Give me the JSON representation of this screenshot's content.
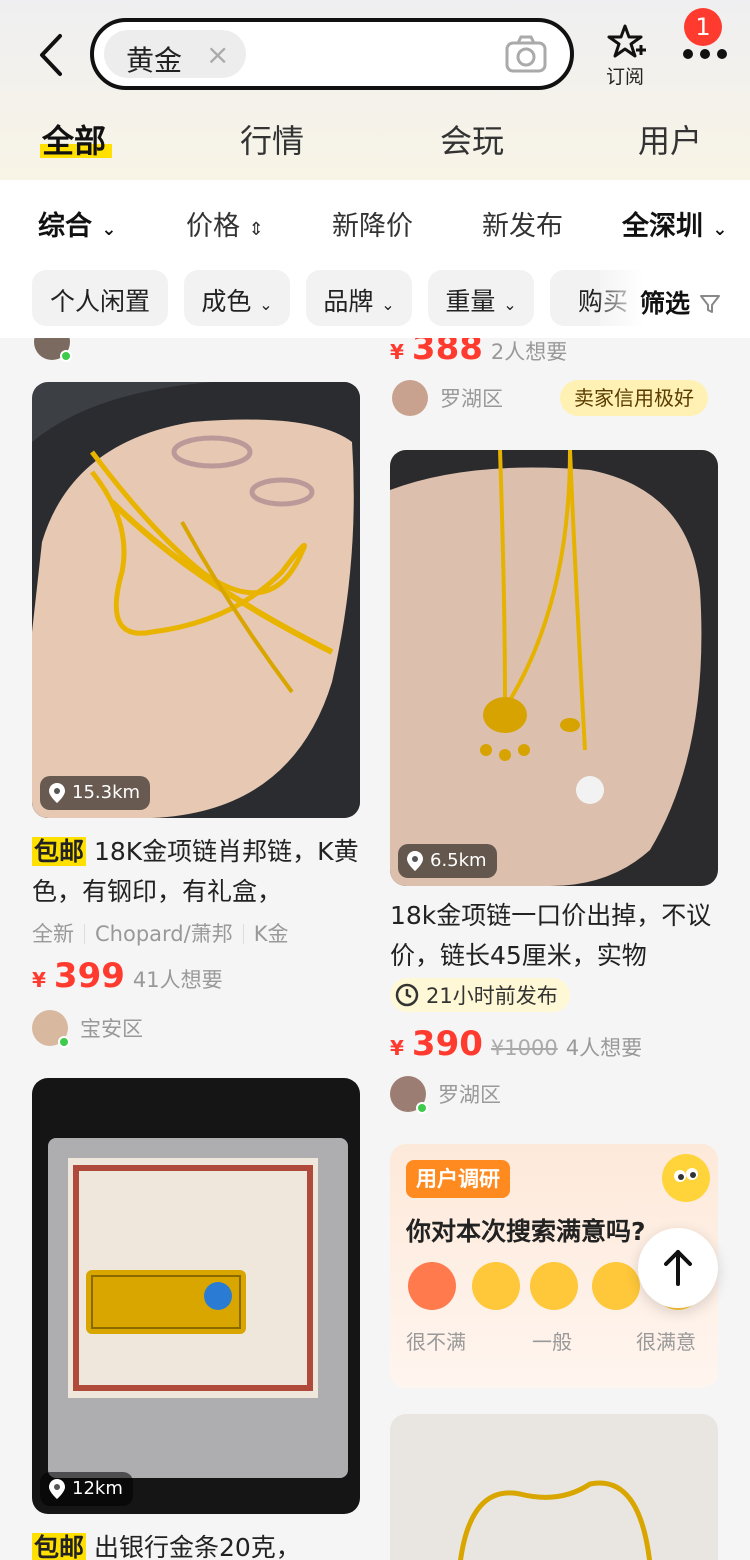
{
  "header": {
    "search_chip": "黄金",
    "subscribe_label": "订阅",
    "notification_count": "1"
  },
  "tabs": [
    "全部",
    "行情",
    "会玩",
    "用户"
  ],
  "sort": {
    "comprehensive": "综合",
    "price": "价格",
    "price_drop": "新降价",
    "new_post": "新发布",
    "region": "全深圳"
  },
  "filters": {
    "chips": [
      "个人闲置",
      "成色",
      "品牌",
      "重量",
      "购买"
    ],
    "filter_label": "筛选"
  },
  "partial_top": {
    "price": "388",
    "want": "2人想要",
    "area": "罗湖区",
    "credit": "卖家信用极好"
  },
  "items": [
    {
      "distance": "15.3km",
      "badge": "包邮",
      "title": "18K金项链肖邦链，K黄色，有钢印，有礼盒，",
      "tags": [
        "全新",
        "Chopard/萧邦",
        "K金"
      ],
      "price": "399",
      "want": "41人想要",
      "area": "宝安区"
    },
    {
      "distance": "6.5km",
      "title": "18k金项链一口价出掉，不议价，链长45厘米，实物",
      "time": "21小时前发布",
      "price": "390",
      "original_price": "¥1000",
      "want": "4人想要",
      "area": "罗湖区"
    },
    {
      "distance": "12km",
      "badge": "包邮",
      "title": "出银行金条20克，"
    }
  ],
  "survey": {
    "tag": "用户调研",
    "question": "你对本次搜索满意吗?",
    "labels": [
      "很不满",
      "一般",
      "很满意"
    ]
  },
  "colors": {
    "accent_yellow": "#ffe000",
    "price_red": "#ff3b30",
    "survey_orange": "#ff8a1f"
  }
}
